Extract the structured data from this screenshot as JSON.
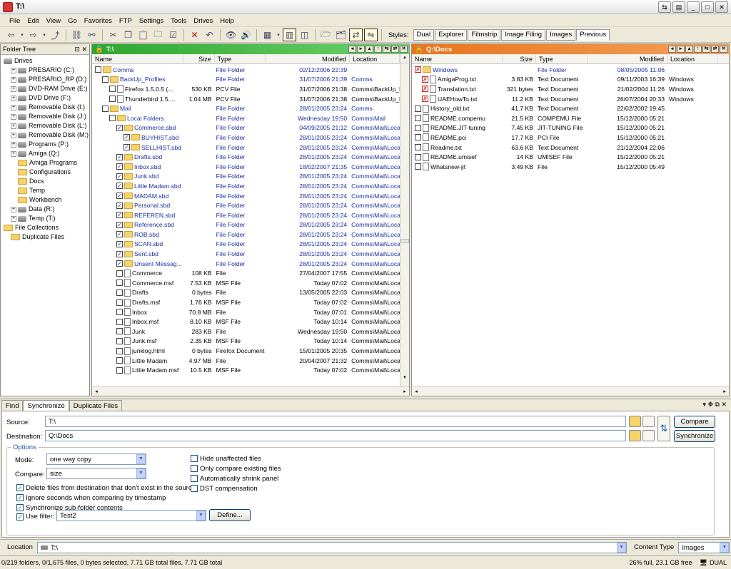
{
  "window": {
    "title": "T:\\"
  },
  "menu": [
    "File",
    "Edit",
    "View",
    "Go",
    "Favorites",
    "FTP",
    "Settings",
    "Tools",
    "Drives",
    "Help"
  ],
  "styles": {
    "label": "Styles:",
    "buttons": [
      "Dual",
      "Explorer",
      "Filmstrip",
      "Image Filing",
      "Images",
      "Previous"
    ],
    "active": "Previous"
  },
  "tree": {
    "title": "Folder Tree",
    "items": [
      {
        "label": "Drives",
        "level": 0,
        "icon": "drive-icon"
      },
      {
        "label": "PRESARIO (C:)",
        "level": 1,
        "icon": "drive-icon"
      },
      {
        "label": "PRESARIO_RP (D:)",
        "level": 1,
        "icon": "drive-icon"
      },
      {
        "label": "DVD-RAM Drive (E:)",
        "level": 1,
        "icon": "drive-icon"
      },
      {
        "label": "DVD Drive (F:)",
        "level": 1,
        "icon": "drive-icon"
      },
      {
        "label": "Removable Disk (I:)",
        "level": 1,
        "icon": "drive-icon"
      },
      {
        "label": "Removable Disk (J:)",
        "level": 1,
        "icon": "drive-icon"
      },
      {
        "label": "Removable Disk (L:)",
        "level": 1,
        "icon": "drive-icon"
      },
      {
        "label": "Removable Disk (M:)",
        "level": 1,
        "icon": "drive-icon"
      },
      {
        "label": "Programs (P:)",
        "level": 1,
        "icon": "drive-icon"
      },
      {
        "label": "Amiga (Q:)",
        "level": 1,
        "icon": "drive-icon"
      },
      {
        "label": "Amiga Programs",
        "level": 2,
        "icon": "folder-icon"
      },
      {
        "label": "Configurations",
        "level": 2,
        "icon": "folder-icon"
      },
      {
        "label": "Docs",
        "level": 2,
        "icon": "folder-icon"
      },
      {
        "label": "Temp",
        "level": 2,
        "icon": "folder-icon"
      },
      {
        "label": "Workbench",
        "level": 2,
        "icon": "folder-icon"
      },
      {
        "label": "Data (R:)",
        "level": 1,
        "icon": "drive-icon"
      },
      {
        "label": "Temp (T:)",
        "level": 1,
        "icon": "drive-icon"
      },
      {
        "label": "File Collections",
        "level": 0,
        "icon": "folder-icon"
      },
      {
        "label": "Duplicate Files",
        "level": 1,
        "icon": "folder-icon"
      }
    ]
  },
  "left_pane": {
    "path": "T:\\",
    "columns": [
      "Name",
      "Size",
      "Type",
      "Modified",
      "Location"
    ],
    "rows": [
      {
        "indent": 0,
        "check": "",
        "icon": "folder",
        "name": "Comms",
        "size": "",
        "type": "File Folder",
        "modified": "02/12/2006 22:39",
        "location": "",
        "dir": true
      },
      {
        "indent": 1,
        "check": "",
        "icon": "folder",
        "name": "BackUp_Profiles",
        "size": "",
        "type": "File Folder",
        "modified": "31/07/2006 21:39",
        "location": "Comms",
        "dir": true
      },
      {
        "indent": 2,
        "check": "",
        "icon": "file",
        "name": "Firefox 1.5.0.5 (...",
        "size": "530 KB",
        "type": "PCV File",
        "modified": "31/07/2006 21:38",
        "location": "Comms\\BackUp_Profile",
        "dir": false
      },
      {
        "indent": 2,
        "check": "",
        "icon": "file",
        "name": "Thunderbird 1.5....",
        "size": "1.04 MB",
        "type": "PCV File",
        "modified": "31/07/2006 21:38",
        "location": "Comms\\BackUp_Profile",
        "dir": false
      },
      {
        "indent": 1,
        "check": "",
        "icon": "folder",
        "name": "Mail",
        "size": "",
        "type": "File Folder",
        "modified": "28/01/2005 23:24",
        "location": "Comms",
        "dir": true
      },
      {
        "indent": 2,
        "check": "",
        "icon": "folder",
        "name": "Local Folders",
        "size": "",
        "type": "File Folder",
        "modified": "Wednesday 19:50",
        "location": "Comms\\Mail",
        "dir": true
      },
      {
        "indent": 3,
        "check": "✓",
        "icon": "folder",
        "name": "Commerce.sbd",
        "size": "",
        "type": "File Folder",
        "modified": "04/09/2005 21:12",
        "location": "Comms\\Mail\\Local Folde",
        "dir": true
      },
      {
        "indent": 4,
        "check": "✓",
        "icon": "folder",
        "name": "BUYHIST.sbd",
        "size": "",
        "type": "File Folder",
        "modified": "28/01/2005 23:24",
        "location": "Comms\\Mail\\Local Folde",
        "dir": true
      },
      {
        "indent": 4,
        "check": "✓",
        "icon": "folder",
        "name": "SELLHIST.sbd",
        "size": "",
        "type": "File Folder",
        "modified": "28/01/2005 23:24",
        "location": "Comms\\Mail\\Local Folde",
        "dir": true
      },
      {
        "indent": 3,
        "check": "✓",
        "icon": "folder",
        "name": "Drafts.sbd",
        "size": "",
        "type": "File Folder",
        "modified": "28/01/2005 23:24",
        "location": "Comms\\Mail\\Local Folde",
        "dir": true
      },
      {
        "indent": 3,
        "check": "✓",
        "icon": "folder",
        "name": "Inbox.sbd",
        "size": "",
        "type": "File Folder",
        "modified": "18/02/2007 21:35",
        "location": "Comms\\Mail\\Local Folde",
        "dir": true
      },
      {
        "indent": 3,
        "check": "✓",
        "icon": "folder",
        "name": "Junk.sbd",
        "size": "",
        "type": "File Folder",
        "modified": "28/01/2005 23:24",
        "location": "Comms\\Mail\\Local Folde",
        "dir": true
      },
      {
        "indent": 3,
        "check": "✓",
        "icon": "folder",
        "name": "Little Madam.sbd",
        "size": "",
        "type": "File Folder",
        "modified": "28/01/2005 23:24",
        "location": "Comms\\Mail\\Local Folde",
        "dir": true
      },
      {
        "indent": 3,
        "check": "✓",
        "icon": "folder",
        "name": "MADAM.sbd",
        "size": "",
        "type": "File Folder",
        "modified": "28/01/2005 23:24",
        "location": "Comms\\Mail\\Local Folde",
        "dir": true
      },
      {
        "indent": 3,
        "check": "✓",
        "icon": "folder",
        "name": "Personal.sbd",
        "size": "",
        "type": "File Folder",
        "modified": "28/01/2005 23:24",
        "location": "Comms\\Mail\\Local Folde",
        "dir": true
      },
      {
        "indent": 3,
        "check": "✓",
        "icon": "folder",
        "name": "REFEREN.sbd",
        "size": "",
        "type": "File Folder",
        "modified": "28/01/2005 23:24",
        "location": "Comms\\Mail\\Local Folde",
        "dir": true
      },
      {
        "indent": 3,
        "check": "✓",
        "icon": "folder",
        "name": "Reference.sbd",
        "size": "",
        "type": "File Folder",
        "modified": "28/01/2005 23:24",
        "location": "Comms\\Mail\\Local Folde",
        "dir": true
      },
      {
        "indent": 3,
        "check": "✓",
        "icon": "folder",
        "name": "ROB.sbd",
        "size": "",
        "type": "File Folder",
        "modified": "28/01/2005 23:24",
        "location": "Comms\\Mail\\Local Folde",
        "dir": true
      },
      {
        "indent": 3,
        "check": "✓",
        "icon": "folder",
        "name": "SCAN.sbd",
        "size": "",
        "type": "File Folder",
        "modified": "28/01/2005 23:24",
        "location": "Comms\\Mail\\Local Folde",
        "dir": true
      },
      {
        "indent": 3,
        "check": "✓",
        "icon": "folder",
        "name": "Sent.sbd",
        "size": "",
        "type": "File Folder",
        "modified": "28/01/2005 23:24",
        "location": "Comms\\Mail\\Local Folde",
        "dir": true
      },
      {
        "indent": 3,
        "check": "✓",
        "icon": "folder",
        "name": "Unsent Messag...",
        "size": "",
        "type": "File Folder",
        "modified": "28/01/2005 23:24",
        "location": "Comms\\Mail\\Local Folde",
        "dir": true
      },
      {
        "indent": 3,
        "check": "",
        "icon": "file",
        "name": "Commerce",
        "size": "108 KB",
        "type": "File",
        "modified": "27/04/2007 17:55",
        "location": "Comms\\Mail\\Local Folde",
        "dir": false
      },
      {
        "indent": 3,
        "check": "",
        "icon": "file",
        "name": "Commerce.msf",
        "size": "7.53 KB",
        "type": "MSF File",
        "modified": "Today 07:02",
        "location": "Comms\\Mail\\Local Folde",
        "dir": false
      },
      {
        "indent": 3,
        "check": "",
        "icon": "file",
        "name": "Drafts",
        "size": "0 bytes",
        "type": "File",
        "modified": "13/05/2005 22:03",
        "location": "Comms\\Mail\\Local Folde",
        "dir": false
      },
      {
        "indent": 3,
        "check": "",
        "icon": "file",
        "name": "Drafts.msf",
        "size": "1.76 KB",
        "type": "MSF File",
        "modified": "Today 07:02",
        "location": "Comms\\Mail\\Local Folde",
        "dir": false
      },
      {
        "indent": 3,
        "check": "",
        "icon": "file",
        "name": "Inbox",
        "size": "70.8 MB",
        "type": "File",
        "modified": "Today 07:01",
        "location": "Comms\\Mail\\Local Folde",
        "dir": false
      },
      {
        "indent": 3,
        "check": "",
        "icon": "file",
        "name": "Inbox.msf",
        "size": "8.10 KB",
        "type": "MSF File",
        "modified": "Today 10:14",
        "location": "Comms\\Mail\\Local Folde",
        "dir": false
      },
      {
        "indent": 3,
        "check": "",
        "icon": "file",
        "name": "Junk",
        "size": "283 KB",
        "type": "File",
        "modified": "Wednesday 19:50",
        "location": "Comms\\Mail\\Local Folde",
        "dir": false
      },
      {
        "indent": 3,
        "check": "",
        "icon": "file",
        "name": "Junk.msf",
        "size": "2.35 KB",
        "type": "MSF File",
        "modified": "Today 10:14",
        "location": "Comms\\Mail\\Local Folde",
        "dir": false
      },
      {
        "indent": 3,
        "check": "",
        "icon": "file",
        "name": "junklog.html",
        "size": "0 bytes",
        "type": "Firefox Document",
        "modified": "15/01/2005 20:35",
        "location": "Comms\\Mail\\Local Folde",
        "dir": false
      },
      {
        "indent": 3,
        "check": "",
        "icon": "file",
        "name": "Little Madam",
        "size": "4.97 MB",
        "type": "File",
        "modified": "20/04/2007 21:32",
        "location": "Comms\\Mail\\Local Folde",
        "dir": false
      },
      {
        "indent": 3,
        "check": "",
        "icon": "file",
        "name": "Little Madam.msf",
        "size": "10.5 KB",
        "type": "MSF File",
        "modified": "Today 07:02",
        "location": "Comms\\Mail\\Local Folde",
        "dir": false
      }
    ]
  },
  "right_pane": {
    "path": "Q:\\Docs",
    "columns": [
      "Name",
      "Size",
      "Type",
      "Modified",
      "Location"
    ],
    "rows": [
      {
        "indent": 0,
        "check": "✗",
        "icon": "folder",
        "name": "Windows",
        "size": "",
        "type": "File Folder",
        "modified": "08/05/2005 11:06",
        "location": "",
        "dir": true
      },
      {
        "indent": 1,
        "check": "✗",
        "icon": "file",
        "name": "AmigaProg.txt",
        "size": "3.83 KB",
        "type": "Text Document",
        "modified": "09/11/2003 16:39",
        "location": "Windows",
        "dir": false
      },
      {
        "indent": 1,
        "check": "✗",
        "icon": "file",
        "name": "Translation.txt",
        "size": "321 bytes",
        "type": "Text Document",
        "modified": "21/02/2004 11:26",
        "location": "Windows",
        "dir": false
      },
      {
        "indent": 1,
        "check": "✗",
        "icon": "file",
        "name": "UAEHowTo.txt",
        "size": "11.2 KB",
        "type": "Text Document",
        "modified": "26/07/2004 20:33",
        "location": "Windows",
        "dir": false
      },
      {
        "indent": 0,
        "check": "",
        "icon": "file",
        "name": "History_old.txt",
        "size": "41.7 KB",
        "type": "Text Document",
        "modified": "22/02/2002 19:45",
        "location": "",
        "dir": false
      },
      {
        "indent": 0,
        "check": "",
        "icon": "file",
        "name": "README.compemu",
        "size": "21.5 KB",
        "type": "COMPEMU File",
        "modified": "15/12/2000 05:21",
        "location": "",
        "dir": false
      },
      {
        "indent": 0,
        "check": "",
        "icon": "file",
        "name": "README.JIT-tuning",
        "size": "7.45 KB",
        "type": "JIT-TUNING File",
        "modified": "15/12/2000 05:21",
        "location": "",
        "dir": false
      },
      {
        "indent": 0,
        "check": "",
        "icon": "file",
        "name": "README.pci",
        "size": "17.7 KB",
        "type": "PCI File",
        "modified": "15/12/2000 05:21",
        "location": "",
        "dir": false
      },
      {
        "indent": 0,
        "check": "",
        "icon": "file",
        "name": "Readme.txt",
        "size": "63.6 KB",
        "type": "Text Document",
        "modified": "21/12/2004 22:06",
        "location": "",
        "dir": false
      },
      {
        "indent": 0,
        "check": "",
        "icon": "file",
        "name": "README.umisef",
        "size": "14 KB",
        "type": "UMISEF File",
        "modified": "15/12/2000 05:21",
        "location": "",
        "dir": false
      },
      {
        "indent": 0,
        "check": "",
        "icon": "file",
        "name": "Whatsnew-jit",
        "size": "3.49 KB",
        "type": "File",
        "modified": "15/12/2000 05:49",
        "location": "",
        "dir": false
      }
    ]
  },
  "sync": {
    "tabs": [
      "Find",
      "Synchronize",
      "Duplicate Files"
    ],
    "active_tab": "Synchronize",
    "source_label": "Source:",
    "source_value": "T:\\",
    "destination_label": "Destination:",
    "destination_value": "Q:\\Docs",
    "compare_button": "Compare",
    "synchronize_button": "Synchronize",
    "options_label": "Options",
    "mode_label": "Mode:",
    "mode_value": "one way copy",
    "compare_label": "Compare:",
    "compare_value": "size",
    "checks_left": [
      {
        "label": "Delete files from destination that don't exist in the source",
        "checked": true
      },
      {
        "label": "Ignore seconds when comparing by timestamp",
        "checked": true
      },
      {
        "label": "Synchronize sub-folder contents",
        "checked": true
      }
    ],
    "use_filter_label": "Use filter:",
    "use_filter_checked": true,
    "filter_value": "Test2",
    "define_button": "Define...",
    "checks_right": [
      {
        "label": "Hide unaffected files",
        "checked": false
      },
      {
        "label": "Only compare existing files",
        "checked": false
      },
      {
        "label": "Automatically shrink panel",
        "checked": false
      },
      {
        "label": "DST compensation",
        "checked": false
      }
    ]
  },
  "location_bar": {
    "label": "Location",
    "value": "T:\\",
    "content_type_label": "Content Type",
    "content_type_value": "Images"
  },
  "status": {
    "left": "0/219 folders, 0/1,675 files, 0 bytes selected, 7.71 GB total files, 7.71 GB total",
    "right": "26% full, 23.1 GB free",
    "mode": "DUAL"
  }
}
